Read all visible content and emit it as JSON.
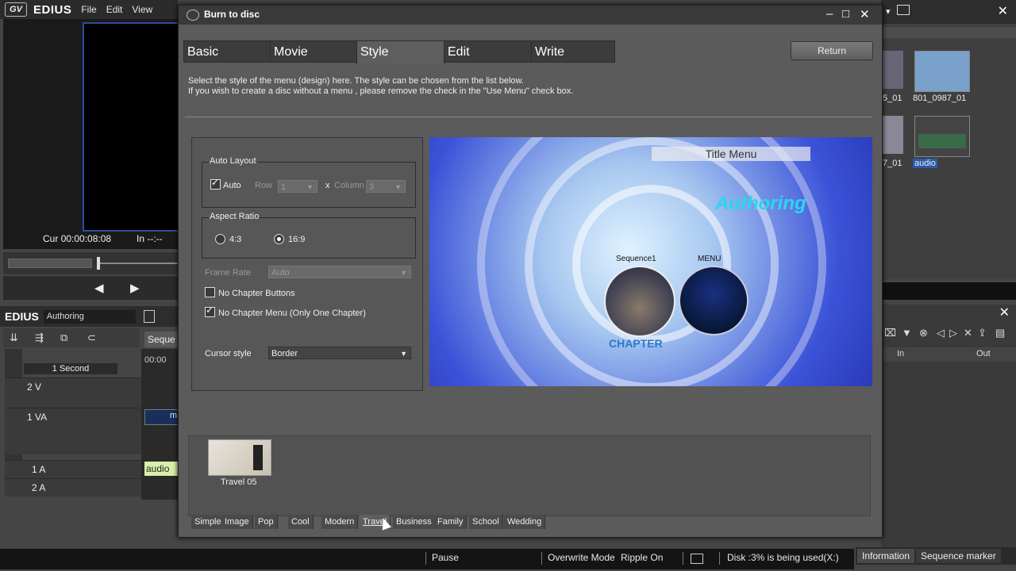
{
  "app": {
    "logo": "GV",
    "brand": "EDIUS",
    "menu": [
      "File",
      "Edit",
      "View"
    ]
  },
  "player": {
    "cur_label": "Cur",
    "cur_tc": "00:00:08:08",
    "in_label": "In",
    "in_tc": "--:--"
  },
  "timeline": {
    "brand": "EDIUS",
    "project": "Authoring",
    "seq_tab": "Seque",
    "scale": "1 Second",
    "ruler_tc": "00:00",
    "tracks": [
      "2 V",
      "1 VA",
      "1 A",
      "2 A"
    ],
    "clip_audio": "audio",
    "clip_video": "m"
  },
  "bin": {
    "items": [
      {
        "label": "5_01"
      },
      {
        "label": "801_0987_01"
      },
      {
        "label": "7_01"
      },
      {
        "label": "audio"
      }
    ],
    "marker_cols": {
      "in": "In",
      "out": "Out"
    },
    "tabs": [
      "Information",
      "Sequence marker"
    ]
  },
  "status": {
    "pause": "Pause",
    "mode": "Overwrite Mode",
    "ripple": "Ripple On",
    "disk": "Disk :3% is being used(X:)"
  },
  "dialog": {
    "title": "Burn to disc",
    "tabs": [
      "Basic",
      "Movie",
      "Style",
      "Edit",
      "Write"
    ],
    "active_tab": "Style",
    "return_label": "Return",
    "instructions": [
      "Select the style of the menu (design) here. The style can be chosen from the list below.",
      "If you wish to create a disc without a menu , please remove the check in the \"Use Menu\" check box."
    ],
    "auto_layout": {
      "title": "Auto Layout",
      "auto_label": "Auto",
      "auto_checked": true,
      "row_label": "Row",
      "row_value": "1",
      "x_label": "x",
      "column_label": "Column",
      "column_value": "3"
    },
    "aspect": {
      "title": "Aspect Ratio",
      "opt1": "4:3",
      "opt2": "16:9",
      "selected": "16:9"
    },
    "frame_rate": {
      "label": "Frame Rate",
      "value": "Auto"
    },
    "no_chapter_buttons": {
      "label": "No Chapter Buttons",
      "checked": false
    },
    "no_chapter_menu": {
      "label": "No Chapter Menu (Only One Chapter)",
      "checked": true
    },
    "cursor_style": {
      "label": "Cursor style",
      "value": "Border"
    },
    "preview": {
      "title": "Title Menu",
      "heading": "Authoring",
      "item1": "Sequence1",
      "item2": "MENU",
      "footer": "CHAPTER"
    },
    "style_selected": "Travel 05",
    "categories": [
      "Simple",
      "Image",
      "Pop",
      "Cool",
      "Modern",
      "Travel",
      "Business",
      "Family",
      "School",
      "Wedding"
    ],
    "active_category": "Travel"
  }
}
